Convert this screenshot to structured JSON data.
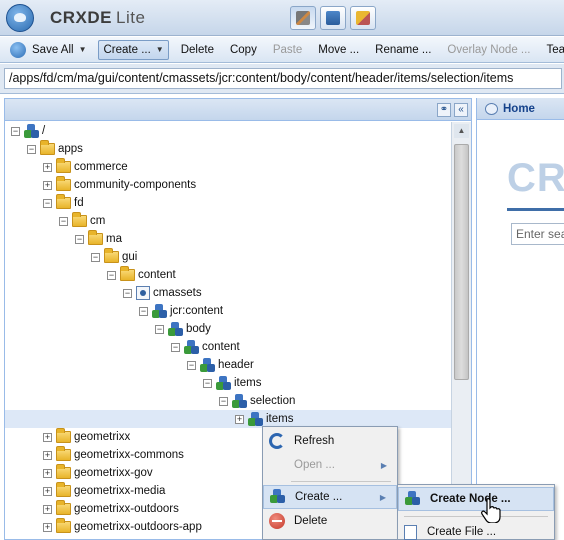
{
  "app": {
    "name": "CRXDE",
    "edition": "Lite"
  },
  "top_tools": [
    {
      "icon": "tools-icon",
      "active": true
    },
    {
      "icon": "package-icon",
      "active": false
    },
    {
      "icon": "folder-tools-icon",
      "active": false
    }
  ],
  "toolbar": {
    "save_all": "Save All",
    "create": "Create ...",
    "delete": "Delete",
    "copy": "Copy",
    "paste": "Paste",
    "move": "Move ...",
    "rename": "Rename ...",
    "overlay_node": "Overlay Node ...",
    "team": "Team"
  },
  "path": "/apps/fd/cm/ma/gui/content/cmassets/jcr:content/body/content/header/items/selection/items",
  "tree": [
    {
      "label": "/",
      "icon": "node",
      "expander": "-",
      "depth": 0
    },
    {
      "label": "apps",
      "icon": "folder",
      "expander": "-",
      "depth": 1
    },
    {
      "label": "commerce",
      "icon": "folder",
      "expander": "+",
      "depth": 2
    },
    {
      "label": "community-components",
      "icon": "folder",
      "expander": "+",
      "depth": 2
    },
    {
      "label": "fd",
      "icon": "folder",
      "expander": "-",
      "depth": 2
    },
    {
      "label": "cm",
      "icon": "folder",
      "expander": "-",
      "depth": 3
    },
    {
      "label": "ma",
      "icon": "folder",
      "expander": "-",
      "depth": 4
    },
    {
      "label": "gui",
      "icon": "folder",
      "expander": "-",
      "depth": 5
    },
    {
      "label": "content",
      "icon": "folder",
      "expander": "-",
      "depth": 6
    },
    {
      "label": "cmassets",
      "icon": "page",
      "expander": "-",
      "depth": 7
    },
    {
      "label": "jcr:content",
      "icon": "node",
      "expander": "-",
      "depth": 8
    },
    {
      "label": "body",
      "icon": "node",
      "expander": "-",
      "depth": 9
    },
    {
      "label": "content",
      "icon": "node",
      "expander": "-",
      "depth": 10
    },
    {
      "label": "header",
      "icon": "node",
      "expander": "-",
      "depth": 11
    },
    {
      "label": "items",
      "icon": "node",
      "expander": "-",
      "depth": 12
    },
    {
      "label": "selection",
      "icon": "node",
      "expander": "-",
      "depth": 13
    },
    {
      "label": "items",
      "icon": "node",
      "expander": "+",
      "depth": 14,
      "selected": true
    },
    {
      "label": "geometrixx",
      "icon": "folder",
      "expander": "+",
      "depth": 2
    },
    {
      "label": "geometrixx-commons",
      "icon": "folder",
      "expander": "+",
      "depth": 2
    },
    {
      "label": "geometrixx-gov",
      "icon": "folder",
      "expander": "+",
      "depth": 2
    },
    {
      "label": "geometrixx-media",
      "icon": "folder",
      "expander": "+",
      "depth": 2
    },
    {
      "label": "geometrixx-outdoors",
      "icon": "folder",
      "expander": "+",
      "depth": 2
    },
    {
      "label": "geometrixx-outdoors-app",
      "icon": "folder",
      "expander": "+",
      "depth": 2
    }
  ],
  "right_panel": {
    "tab": "Home",
    "logo_fragment": "CR",
    "search_placeholder": "Enter sea"
  },
  "context_menu": {
    "refresh": "Refresh",
    "open": "Open ...",
    "create": "Create ...",
    "delete": "Delete"
  },
  "create_submenu": {
    "create_node": "Create Node ...",
    "create_file": "Create File ..."
  }
}
